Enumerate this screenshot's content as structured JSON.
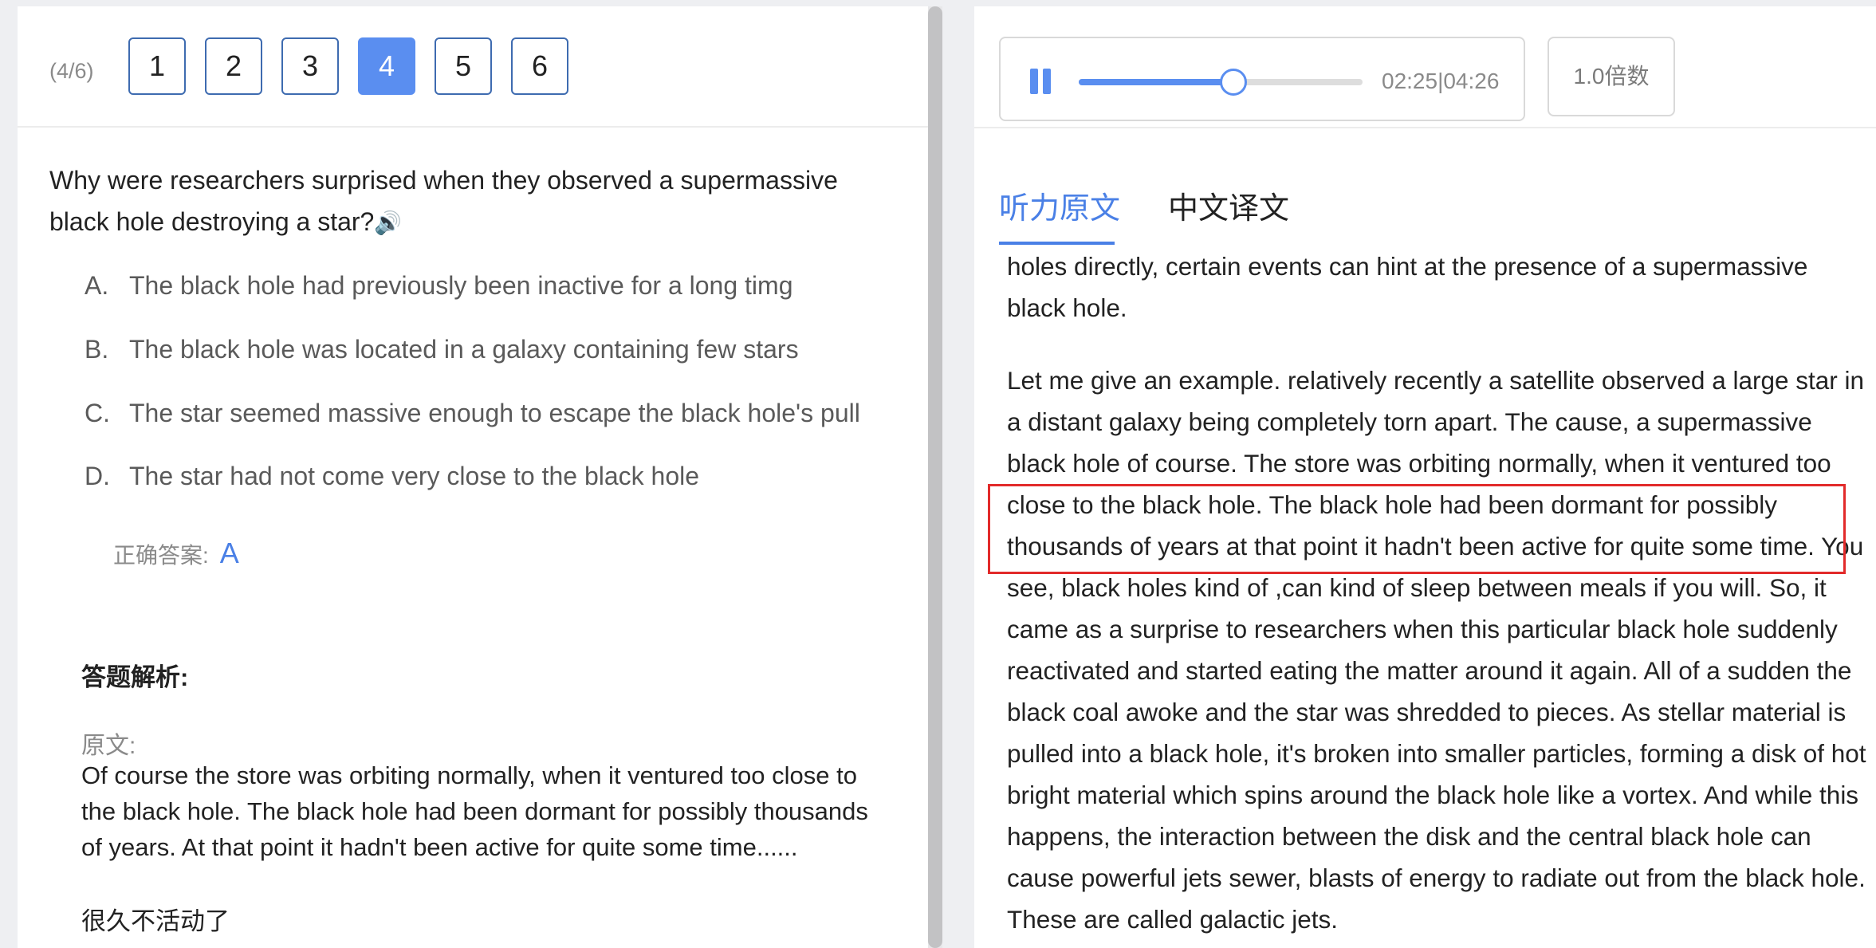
{
  "question_nav": {
    "progress": "(4/6)",
    "numbers": [
      "1",
      "2",
      "3",
      "4",
      "5",
      "6"
    ],
    "active": "4"
  },
  "question": {
    "text": "Why were researchers surprised when they observed a supermassive black hole destroying a star?",
    "speaker_glyph": "🔊",
    "options": [
      {
        "letter": "A.",
        "text": "The black hole had previously been inactive for a long timg"
      },
      {
        "letter": "B.",
        "text": "The black hole was located in a galaxy containing few stars"
      },
      {
        "letter": "C.",
        "text": "The star seemed massive enough to escape the black hole's pull"
      },
      {
        "letter": "D.",
        "text": "The star had not come very close to the black hole"
      }
    ],
    "answer_label": "正确答案:",
    "answer_value": "A"
  },
  "analysis": {
    "title": "答题解析:",
    "source_label": "原文:",
    "source_text": "Of course the store was orbiting normally, when it ventured too close to the black hole. The black hole had been dormant for possibly thousands of years. At that point it hadn't been active for quite some time......",
    "source_cn": "很久不活动了"
  },
  "player": {
    "time": "02:25|04:26",
    "progress_fraction": 0.5451,
    "speed_label": "1.0倍数",
    "accent_color": "#5a8ef0"
  },
  "tabs": {
    "transcript": "听力原文",
    "translation": "中文译文"
  },
  "transcript": {
    "para1": "holes directly, certain events can hint at the presence of a supermassive black hole.",
    "para2_before": "Let me give an example. relatively recently a satellite observed a large star in a distant galaxy being completely torn apart. The cause, a supermassive black hole of course. The store was orbiting normally, when it ventured too",
    "para2_highlight": "close to the black hole. The black hole had been dormant for possibly thousands of years at that point it hadn't been active for quite some time.",
    "para2_after": "You see, black holes kind of ,can kind of sleep between meals if you will. So, it came as a surprise to researchers when this particular black hole suddenly reactivated and started eating the matter around it again. All of a sudden the black coal awoke and the star was shredded to pieces. As stellar material is pulled into a black hole, it's broken into smaller particles, forming a disk of hot bright material which spins around the black hole like a vortex. And while this happens, the interaction between the disk and the central black hole can cause powerful jets sewer, blasts of energy to radiate out from the black hole. These are called galactic jets.",
    "highlight_color": "#e22a2a"
  }
}
